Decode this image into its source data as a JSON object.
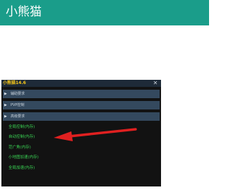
{
  "app": {
    "title": "小熊猫",
    "header_color": "#1a9d8a"
  },
  "panel": {
    "title": "小熊猫14.6",
    "close_icon": "✕",
    "sections": [
      {
        "label": "辅助要求",
        "icon": "play-triangle-icon"
      },
      {
        "label": "PVP控制",
        "icon": "play-triangle-icon"
      },
      {
        "label": "高级要求",
        "icon": "play-triangle-icon"
      }
    ],
    "items": [
      {
        "label": "全局控制(内存)"
      },
      {
        "label": "自动控制(内存)"
      },
      {
        "label": "范广角(内存)"
      },
      {
        "label": "小地图加速(内存)"
      },
      {
        "label": "全局加速(内存)"
      }
    ]
  },
  "annotation": {
    "type": "red-arrow",
    "color": "#e02020",
    "points_to": "自动控制(内存)"
  }
}
